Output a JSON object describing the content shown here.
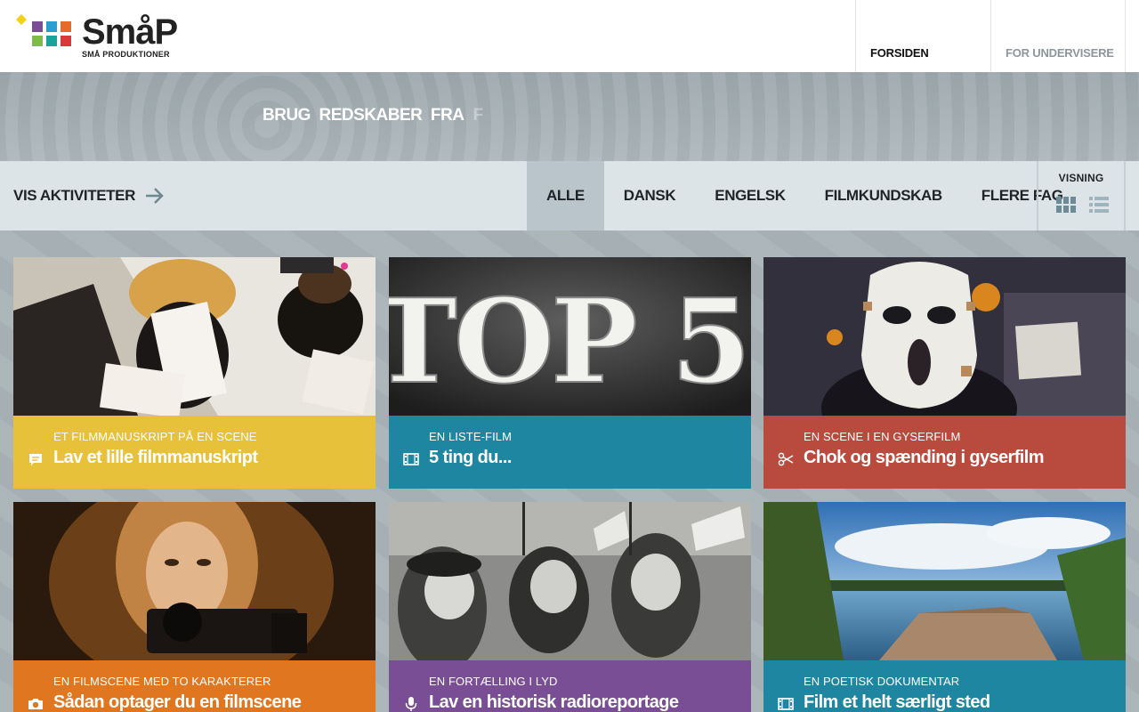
{
  "logo": {
    "wordmark": "SmåP",
    "subtitle": "SMÅ PRODUKTIONER"
  },
  "topnav": [
    {
      "label": "FORSIDEN",
      "active": true
    },
    {
      "label": "FOR UNDERVISERE",
      "active": false
    }
  ],
  "banner": {
    "text": "BRUG  REDSKABER  FRA",
    "fade": "F"
  },
  "filterbar": {
    "vis_aktiviteter": "VIS AKTIVITETER",
    "filters": [
      {
        "label": "ALLE",
        "active": true
      },
      {
        "label": "DANSK",
        "active": false
      },
      {
        "label": "ENGELSK",
        "active": false
      },
      {
        "label": "FILMKUNDSKAB",
        "active": false
      },
      {
        "label": "FLERE FAG",
        "active": false
      }
    ],
    "visning": "VISNING"
  },
  "cards": [
    {
      "subtitle": "ET FILMMANUSKRIPT PÅ EN SCENE",
      "title": "Lav et lille filmmanuskript",
      "icon": "speech-bubble-icon",
      "color": "#e7c13a"
    },
    {
      "subtitle": "EN LISTE-FILM",
      "title": "5 ting du...",
      "icon": "film-strip-icon",
      "color": "#1f86a2"
    },
    {
      "subtitle": "EN SCENE I EN GYSERFILM",
      "title": "Chok og spænding i gyserfilm",
      "icon": "scissors-icon",
      "color": "#b94a3e"
    },
    {
      "subtitle": "EN FILMSCENE MED TO KARAKTERER",
      "title": "Sådan optager du en filmscene",
      "icon": "camera-icon",
      "color": "#e0761f"
    },
    {
      "subtitle": "EN FORTÆLLING I LYD",
      "title": "Lav en historisk radioreportage",
      "icon": "microphone-icon",
      "color": "#7a4e95"
    },
    {
      "subtitle": "EN POETISK DOKUMENTAR",
      "title": "Film et helt særligt sted",
      "icon": "film-strip-icon",
      "color": "#1f86a2"
    }
  ],
  "image_text": {
    "top5": "TOP 5"
  }
}
